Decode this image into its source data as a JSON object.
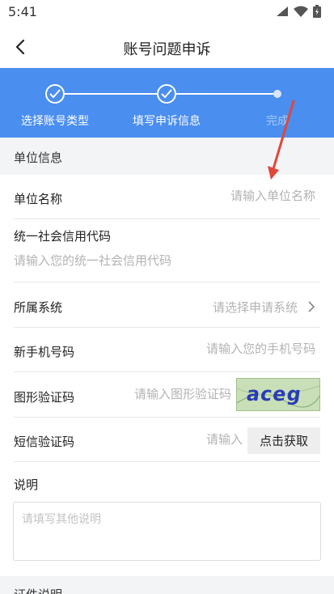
{
  "status_bar": {
    "time": "5:41"
  },
  "header": {
    "title": "账号问题申诉"
  },
  "stepper": {
    "steps": [
      {
        "label": "选择账号类型",
        "done": true
      },
      {
        "label": "填写申诉信息",
        "done": true
      },
      {
        "label": "完成",
        "done": false
      }
    ]
  },
  "section": {
    "title": "单位信息"
  },
  "form": {
    "unit_name": {
      "label": "单位名称",
      "placeholder": "请输入单位名称"
    },
    "credit_code": {
      "label": "统一社会信用代码",
      "placeholder": "请输入您的统一社会信用代码"
    },
    "system": {
      "label": "所属系统",
      "placeholder": "请选择申请系统"
    },
    "phone": {
      "label": "新手机号码",
      "placeholder": "请输入您的手机号码"
    },
    "captcha": {
      "label": "图形验证码",
      "placeholder": "请输入图形验证码",
      "image_text": "aceg"
    },
    "sms": {
      "label": "短信验证码",
      "placeholder": "请输入",
      "button": "点击获取"
    },
    "description": {
      "label": "说明",
      "placeholder": "请填写其他说明"
    }
  },
  "bottom": {
    "title": "证件说明"
  },
  "colors": {
    "accent": "#4a8ef0",
    "annotation": "#e0473a"
  }
}
